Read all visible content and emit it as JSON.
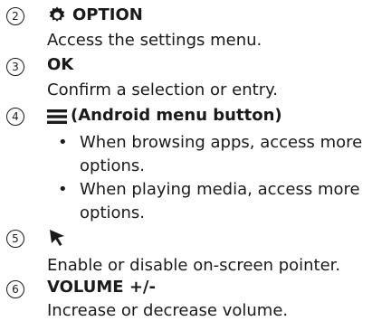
{
  "items": [
    {
      "number": "2",
      "title": "OPTION",
      "icon": "gear-icon",
      "desc": "Access the settings menu."
    },
    {
      "number": "3",
      "title": "OK",
      "desc": "Confirm a selection or entry."
    },
    {
      "number": "4",
      "icon": "hamburger-menu-icon",
      "title_open": "(",
      "title": "Android menu button",
      "title_close": ")",
      "bullets": [
        "When browsing apps, access more options.",
        "When playing media, access more options."
      ]
    },
    {
      "number": "5",
      "icon": "pointer-arrow-icon",
      "desc": "Enable or disable on-screen pointer."
    },
    {
      "number": "6",
      "title": "VOLUME +/-",
      "desc": "Increase or decrease volume."
    }
  ]
}
